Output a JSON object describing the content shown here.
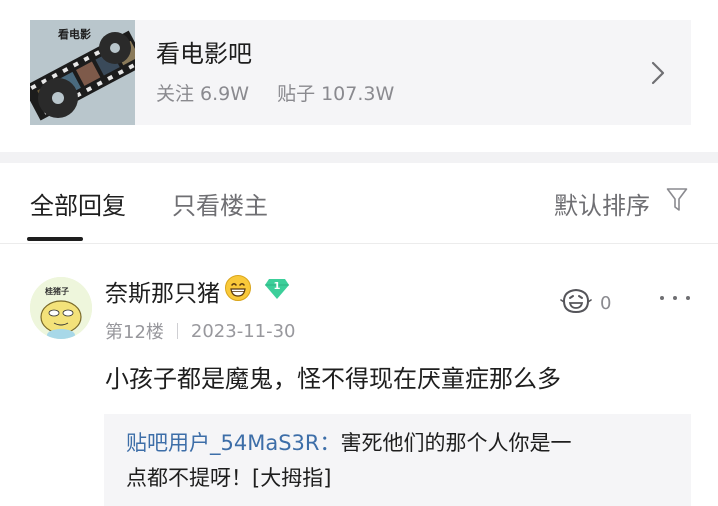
{
  "forum": {
    "name": "看电影吧",
    "thumb_text": "看电影",
    "stats": {
      "follow_label": "关注",
      "follow_value": "6.9W",
      "posts_label": "贴子",
      "posts_value": "107.3W"
    }
  },
  "tabs": {
    "all": "全部回复",
    "op_only": "只看楼主",
    "sort": "默认排序"
  },
  "post": {
    "username": "奈斯那只猪",
    "avatar_text": "桂猪子",
    "floor": "第12楼",
    "date": "2023-11-30",
    "likes": "0",
    "content": "小孩子都是魔鬼，怪不得现在厌童症那么多",
    "reply": {
      "user": "贴吧用户_54MaS3R：",
      "line1": "害死他们的那个人你是一",
      "line2": "点都不提呀！[大拇指]"
    }
  },
  "icons": [
    "chevron-right-icon",
    "filter-icon",
    "grin-emoji-icon",
    "diamond-badge-icon",
    "like-icon",
    "more-icon"
  ],
  "colors": {
    "link_blue": "#3d6ea8",
    "gem_green": "#3ccf9a",
    "gray_text": "#8a8a8f"
  }
}
